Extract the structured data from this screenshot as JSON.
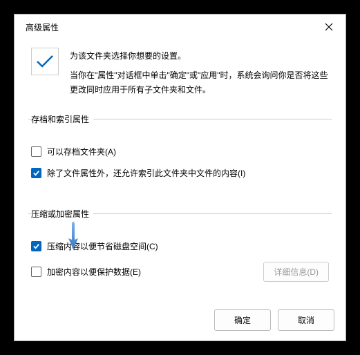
{
  "title": "高级属性",
  "intro": {
    "line1": "为该文件夹选择你想要的设置。",
    "line2": "当你在\"属性\"对话框中单击\"确定\"或\"应用\"时，系统会询问你是否将这些更改同时应用于所有子文件夹和文件。"
  },
  "group1": {
    "legend": "存档和索引属性",
    "cb1": {
      "label": "可以存档文件夹(A)",
      "checked": false
    },
    "cb2": {
      "label": "除了文件属性外，还允许索引此文件夹中文件的内容(I)",
      "checked": true
    }
  },
  "group2": {
    "legend": "压缩或加密属性",
    "cb1": {
      "label": "压缩内容以便节省磁盘空间(C)",
      "checked": true
    },
    "cb2": {
      "label": "加密内容以便保护数据(E)",
      "checked": false
    },
    "details": "详细信息(D)"
  },
  "buttons": {
    "ok": "确定",
    "cancel": "取消"
  }
}
